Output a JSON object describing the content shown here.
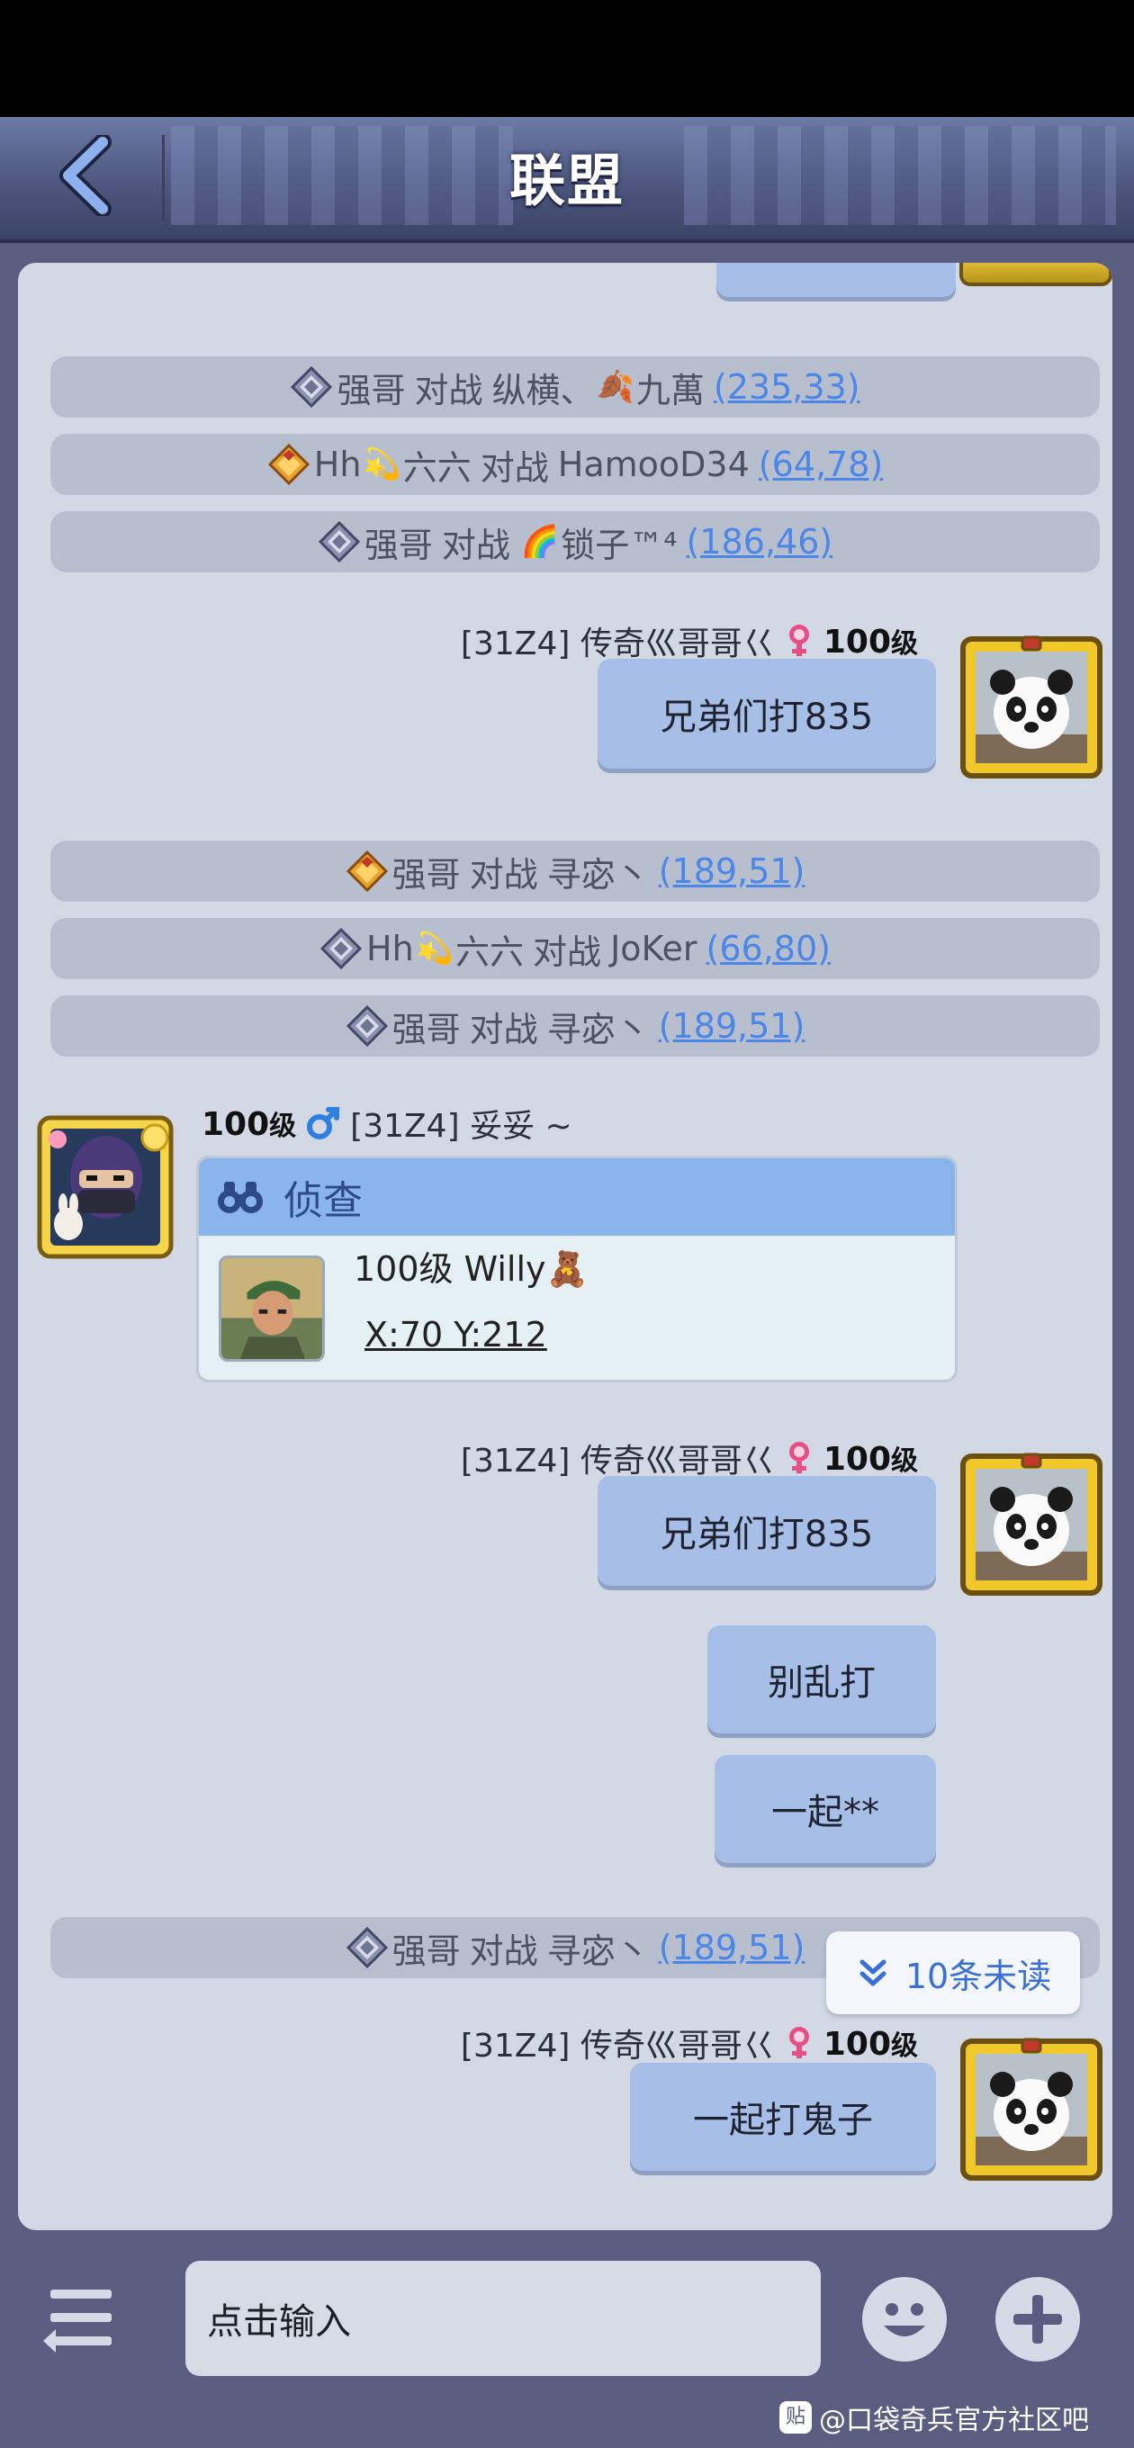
{
  "header": {
    "title": "联盟"
  },
  "system_messages": [
    {
      "name": "强哥",
      "verb": "对战",
      "opponent": "纵横、",
      "opponent2": "九萬",
      "coord": "(235,33)",
      "rank": "silver"
    },
    {
      "name": "Hh",
      "name2": "六六",
      "verb": "对战",
      "opponent": "HamooD34",
      "coord": "(64,78)",
      "rank": "gold"
    },
    {
      "name": "强哥",
      "verb": "对战",
      "opponent": "锁子™⁴",
      "coord": "(186,46)",
      "rank": "silver"
    },
    {
      "name": "强哥",
      "verb": "对战",
      "opponent": "寻宓丶",
      "coord": "(189,51)",
      "rank": "gold"
    },
    {
      "name": "Hh",
      "name2": "六六",
      "verb": "对战",
      "opponent": "JoKer",
      "coord": "(66,80)",
      "rank": "silver"
    },
    {
      "name": "强哥",
      "verb": "对战",
      "opponent": "寻宓丶",
      "coord": "(189,51)",
      "rank": "silver"
    },
    {
      "name": "强哥",
      "verb": "对战",
      "opponent": "寻宓丶",
      "coord": "(189,51)",
      "rank": "silver"
    }
  ],
  "sender_right": {
    "name": "[31Z4] 传奇巛哥哥巜",
    "level": "100",
    "level_unit": "级"
  },
  "sender_left": {
    "level": "100",
    "level_unit": "级",
    "name": "[31Z4] 妥妥 ~"
  },
  "messages_right": {
    "m1": "兄弟们打835",
    "m2": "兄弟们打835",
    "m3": "别乱打",
    "m4": "一起**",
    "m5": "一起打鬼子"
  },
  "scout_card": {
    "title": "侦查",
    "target": "100级  Willy",
    "coords": "X:70 Y:212"
  },
  "unread": {
    "label": "10条未读"
  },
  "input": {
    "placeholder": "点击输入"
  },
  "watermark": {
    "text": "@口袋奇兵官方社区吧"
  },
  "colors": {
    "accent": "#4c86e6",
    "bubble": "#a7bfe6",
    "system_bg": "#b7bfcf",
    "chat_bg": "#d2d9e5"
  }
}
